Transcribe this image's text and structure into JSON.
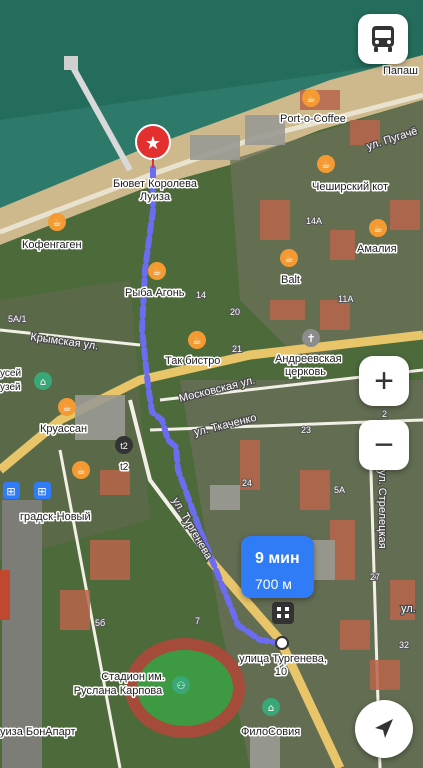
{
  "map": {
    "pois": {
      "start": "Бювет Королева Луиза",
      "start_l1": "Бювет Королева",
      "start_l2": "Луиза",
      "port": "Port-o-Coffee",
      "cheshire": "Чеширский кот",
      "amalia": "Амалия",
      "kofe": "Кофенгаген",
      "ryba": "Рыба Агонь",
      "balt": "Balt",
      "tak": "Так бистро",
      "church_l1": "Андреевская",
      "church_l2": "церковь",
      "kruassan": "Круассан",
      "bus_t2": "t2",
      "station": "градск-Новый",
      "stadium_l1": "Стадион им.",
      "stadium_l2": "Руслана Карпова",
      "filo": "ФилоСовия",
      "bonapart": "уиза БонАпарт",
      "museum": "узей",
      "muz_l1": "усей",
      "papash": "Папаш",
      "destination_l1": "улица Тургенева,",
      "destination_l2": "10"
    },
    "streets": {
      "krymskaya": "Крымская ул.",
      "moskovskaya": "Московская ул.",
      "tkachenko": "ул. Ткаченко",
      "turgeneva": "ул. Тургенева",
      "pugacheva": "ул. Пугачё",
      "vertical_right": "ул. Стрелецкая",
      "ul_right": "ул."
    },
    "numbers": [
      "14А",
      "11А",
      "20",
      "21",
      "23",
      "5А",
      "2",
      "27",
      "32",
      "37",
      "5б",
      "7",
      "5А/1",
      "24",
      "14"
    ]
  },
  "route": {
    "time": "9 мин",
    "distance": "700 м"
  },
  "controls": {
    "zoom_in": "+",
    "zoom_out": "−"
  },
  "colors": {
    "route": "#6b6cf0",
    "accent": "#2f7cf6",
    "poi_orange": "#f39a33",
    "start_red": "#e3302f"
  }
}
